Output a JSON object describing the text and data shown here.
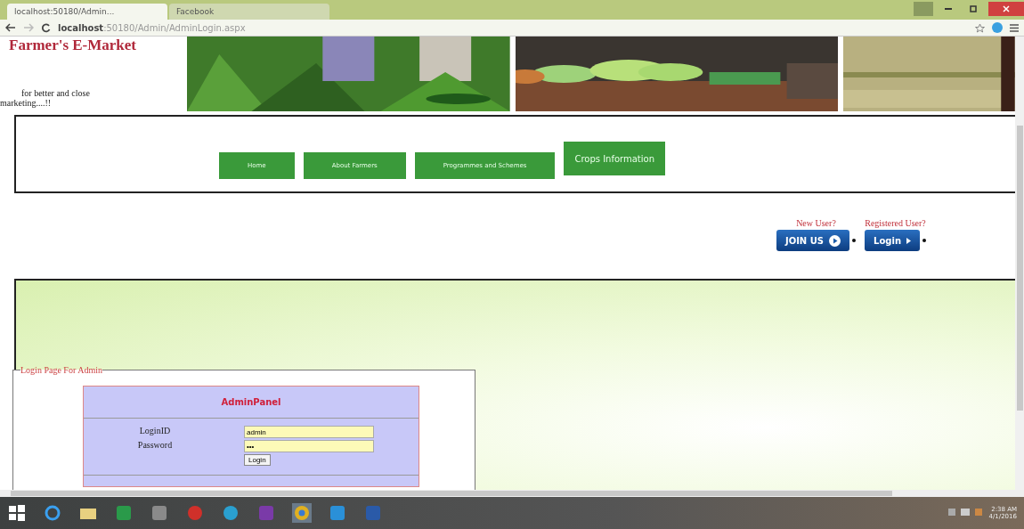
{
  "browser": {
    "tabs": [
      {
        "title": "localhost:50180/Admin...",
        "selected": true
      },
      {
        "title": "Facebook",
        "selected": false
      }
    ],
    "address": {
      "host": "localhost",
      "path": ":50180/Admin/AdminLogin.aspx"
    }
  },
  "header": {
    "title": "Farmer's E-Market",
    "tagline": "for better and close marketing....!!"
  },
  "nav": [
    {
      "label": "Home",
      "selected": false
    },
    {
      "label": "About Farmers",
      "selected": false
    },
    {
      "label": "Programmes and Schemes",
      "selected": false
    },
    {
      "label": "Crops Information",
      "selected": true
    }
  ],
  "account": {
    "new_user": {
      "caption": "New User?",
      "button": "JOIN US"
    },
    "registered_user": {
      "caption": "Registered User?",
      "button": "Login"
    }
  },
  "login_section": {
    "legend": "Login Page For Admin",
    "panel_title": "AdminPanel",
    "fields": [
      {
        "label": "LoginID",
        "value": "admin",
        "kind": "text"
      },
      {
        "label": "Password",
        "value": "•••",
        "kind": "password"
      }
    ],
    "submit": "Login"
  },
  "taskbar": {
    "time": "2:38 AM",
    "date": "4/1/2016"
  }
}
